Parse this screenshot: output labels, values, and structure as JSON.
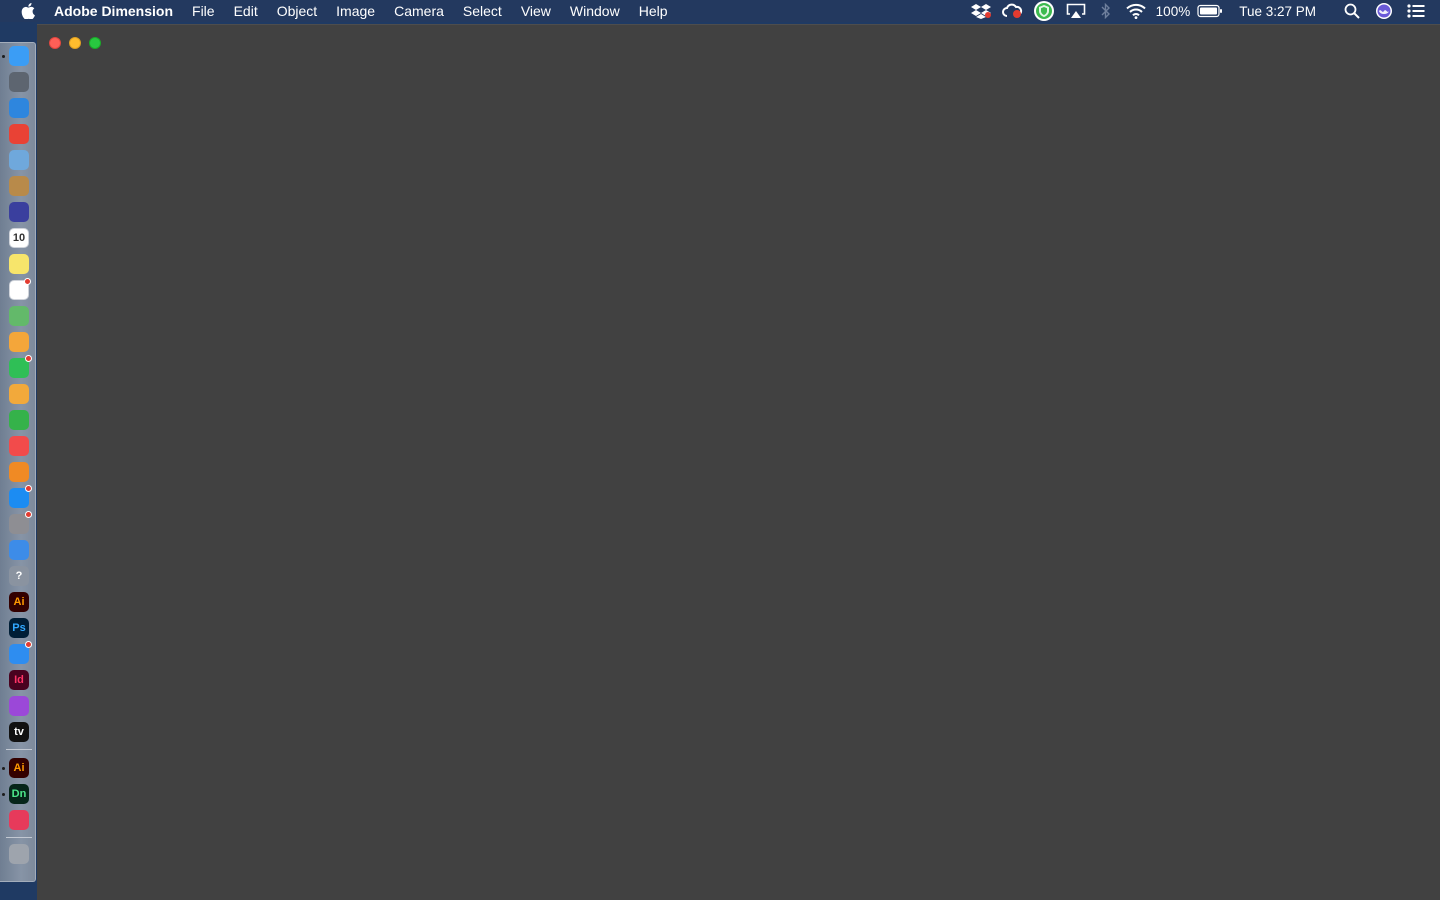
{
  "menubar": {
    "app_name": "Adobe Dimension",
    "menus": [
      "File",
      "Edit",
      "Object",
      "Image",
      "Camera",
      "Select",
      "View",
      "Window",
      "Help"
    ],
    "status": {
      "battery": "100%",
      "clock": "Tue 3:27 PM"
    }
  },
  "dock": {
    "apps": [
      {
        "name": "finder-icon",
        "color": "#3b9df5",
        "running": true
      },
      {
        "name": "launchpad-icon",
        "color": "#5d6570"
      },
      {
        "name": "safari-icon",
        "color": "#2e86de"
      },
      {
        "name": "chrome-icon",
        "color": "#e94235"
      },
      {
        "name": "preview-icon",
        "color": "#6fa8dc"
      },
      {
        "name": "contacts-icon",
        "color": "#b88a4a"
      },
      {
        "name": "siri-icon",
        "color": "#3a3f9e"
      },
      {
        "name": "calendar-icon",
        "color": "#ffffff",
        "text": "10"
      },
      {
        "name": "notes-icon",
        "color": "#f7e56b"
      },
      {
        "name": "reminders-icon",
        "color": "#ffffff",
        "badge": true
      },
      {
        "name": "maps-icon",
        "color": "#63b96a"
      },
      {
        "name": "photos-icon",
        "color": "#f4a63a"
      },
      {
        "name": "facetime-icon",
        "color": "#2fbf56",
        "badge": true
      },
      {
        "name": "pages-icon",
        "color": "#f2a93b"
      },
      {
        "name": "numbers-icon",
        "color": "#35b24a"
      },
      {
        "name": "news-icon",
        "color": "#f24b4b"
      },
      {
        "name": "books-icon",
        "color": "#f08a24"
      },
      {
        "name": "app-store-icon",
        "color": "#1c8cf2",
        "badge": true
      },
      {
        "name": "system-preferences-icon",
        "color": "#8e8e93",
        "badge": true
      },
      {
        "name": "keynote-icon",
        "color": "#3d8ce8"
      },
      {
        "name": "help-icon",
        "color": "#8a93a0",
        "text": "?"
      },
      {
        "name": "illustrator-icon",
        "color": "#330000",
        "text": "Ai",
        "text_color": "#ff9a00"
      },
      {
        "name": "photoshop-icon",
        "color": "#001e36",
        "text": "Ps",
        "text_color": "#31a8ff"
      },
      {
        "name": "messages-icon",
        "color": "#2e8df0",
        "badge": true
      },
      {
        "name": "indesign-icon",
        "color": "#49021f",
        "text": "Id",
        "text_color": "#ff3366"
      },
      {
        "name": "podcasts-icon",
        "color": "#9b48d8"
      },
      {
        "name": "apple-tv-icon",
        "color": "#111111",
        "text": "tv",
        "text_color": "#ffffff"
      }
    ],
    "running_apps": [
      {
        "name": "illustrator-running-icon",
        "color": "#330000",
        "text": "Ai",
        "text_color": "#ff9a00",
        "running": true
      },
      {
        "name": "dimension-icon",
        "color": "#06251a",
        "text": "Dn",
        "text_color": "#4ce68a",
        "running": true
      },
      {
        "name": "creative-cloud-icon",
        "color": "#e73a5b"
      }
    ],
    "trash": {
      "name": "trash-icon",
      "color": "#9ea4ad"
    }
  },
  "window": {
    "background": "#414141"
  }
}
